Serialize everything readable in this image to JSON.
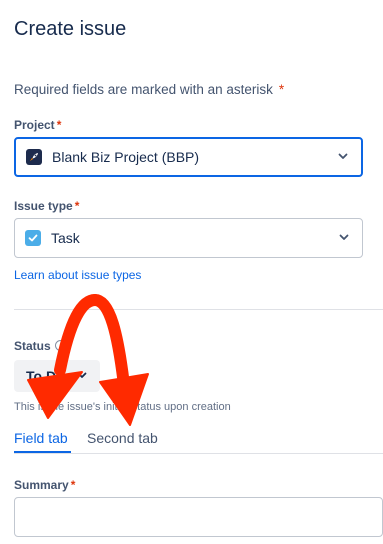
{
  "header": {
    "title": "Create issue"
  },
  "form": {
    "required_note": "Required fields are marked with an asterisk",
    "required_star": "*",
    "project": {
      "label": "Project",
      "star": "*",
      "value": "Blank Biz Project (BBP)",
      "icon": "rocket-icon"
    },
    "issue_type": {
      "label": "Issue type",
      "star": "*",
      "value": "Task",
      "icon": "checkbox-task-icon"
    },
    "learn_link": "Learn about issue types",
    "status": {
      "label": "Status",
      "value": "To Do",
      "help": "This is the issue's initial status upon creation"
    },
    "tabs": [
      {
        "label": "Field tab",
        "active": true
      },
      {
        "label": "Second tab",
        "active": false
      }
    ],
    "summary": {
      "label": "Summary",
      "star": "*",
      "value": ""
    }
  },
  "annotation": {
    "arrow_color": "#ff2a00"
  }
}
